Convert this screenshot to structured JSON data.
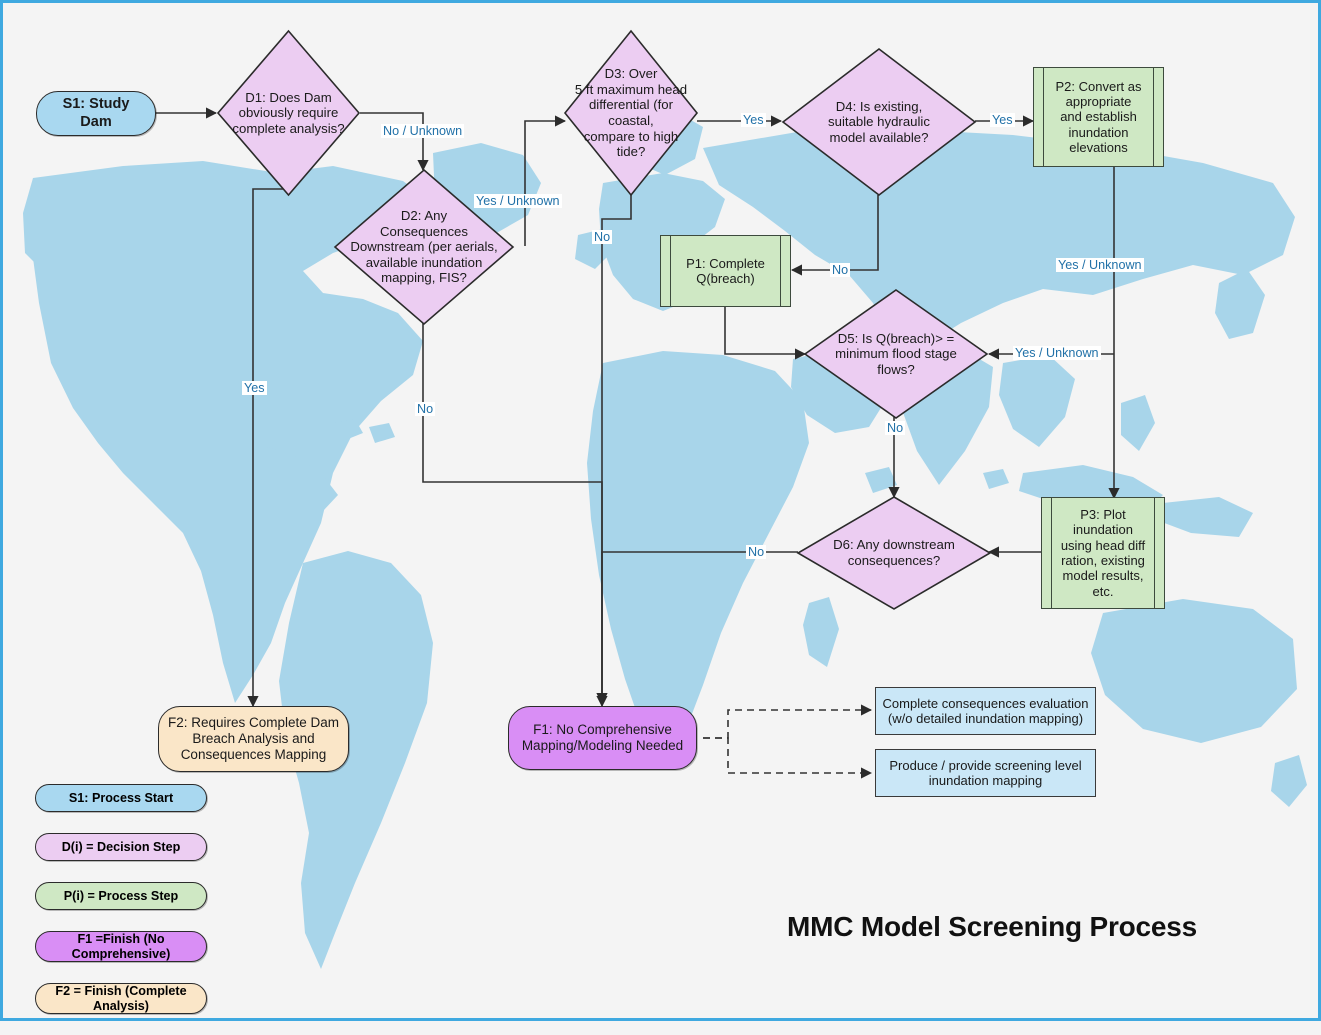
{
  "title": "MMC Model Screening Process",
  "colors": {
    "frame_border": "#3fa9e0",
    "background": "#f4f4f4",
    "map_land": "#a8d5ea",
    "start_fill": "#a9d8f0",
    "decision_fill": "#eccdf2",
    "process_fill": "#cfe8c4",
    "finish_no_comprehensive_fill": "#d98ef5",
    "finish_complete_fill": "#fae6c8",
    "note_fill": "#cae7f7",
    "edge_label_text": "#2171a8",
    "edge_stroke": "#333333"
  },
  "nodes": {
    "s1": {
      "label": "S1: Study\nDam",
      "type": "terminator-start"
    },
    "d1": {
      "label": "D1: Does Dam\nobviously require\ncomplete analysis?",
      "type": "decision"
    },
    "d2": {
      "label": "D2: Any\nConsequences\nDownstream (per aerials,\navailable inundation\nmapping, FIS?",
      "type": "decision"
    },
    "d3": {
      "label": "D3: Over\n5 ft maximum head\ndifferential (for coastal,\ncompare to high\ntide?",
      "type": "decision"
    },
    "d4": {
      "label": "D4: Is existing,\nsuitable hydraulic\nmodel available?",
      "type": "decision"
    },
    "d5": {
      "label": "D5: Is Q(breach)> =\nminimum flood stage\nflows?",
      "type": "decision"
    },
    "d6": {
      "label": "D6: Any downstream\nconsequences?",
      "type": "decision"
    },
    "p1": {
      "label": "P1: Complete\nQ(breach)",
      "type": "process"
    },
    "p2": {
      "label": "P2: Convert as\nappropriate\nand establish\ninundation\nelevations",
      "type": "process"
    },
    "p3": {
      "label": "P3: Plot\ninundation\nusing head diff\nration, existing\nmodel results,\netc.",
      "type": "process"
    },
    "f1": {
      "label": "F1: No Comprehensive\nMapping/Modeling Needed",
      "type": "terminator-finish-purple"
    },
    "f2": {
      "label": "F2: Requires Complete Dam\nBreach Analysis and\nConsequences Mapping",
      "type": "terminator-finish-cream"
    },
    "note1": {
      "label": "Complete consequences evaluation\n(w/o detailed inundation mapping)",
      "type": "note"
    },
    "note2": {
      "label": "Produce / provide screening level\ninundation mapping",
      "type": "note"
    }
  },
  "edge_labels": {
    "d1_no_unknown": "No / Unknown",
    "d1_yes": "Yes",
    "d2_yes_unknown": "Yes / Unknown",
    "d2_no": "No",
    "d3_yes": "Yes",
    "d3_no": "No",
    "d4_yes": "Yes",
    "d4_no": "No",
    "d5_yes_unknown": "Yes / Unknown",
    "d5_no": "No",
    "d6_no": "No",
    "p2_yes_unknown": "Yes / Unknown"
  },
  "legend": {
    "items": [
      {
        "label": "S1: Process Start",
        "fill": "#a9d8f0"
      },
      {
        "label": "D(i) = Decision Step",
        "fill": "#eccdf2"
      },
      {
        "label": "P(i) =  Process Step",
        "fill": "#cfe8c4"
      },
      {
        "label": "F1 =Finish (No\nComprehensive)",
        "fill": "#d98ef5"
      },
      {
        "label": "F2 = Finish (Complete\nAnalysis)",
        "fill": "#fae6c8"
      }
    ]
  }
}
